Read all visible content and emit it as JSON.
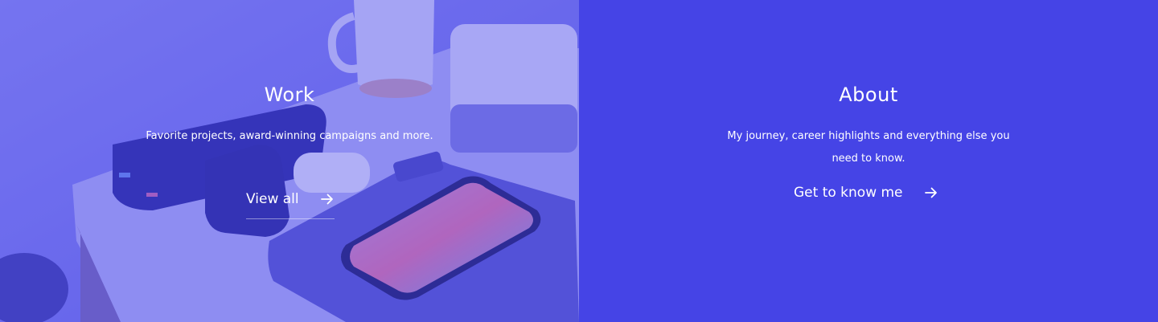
{
  "work": {
    "title": "Work",
    "description": "Favorite projects, award-winning campaigns and more.",
    "cta_label": "View all",
    "cta_icon": "arrow-right-icon",
    "overlay_color": "#6b6bf0"
  },
  "about": {
    "title": "About",
    "description": "My journey, career highlights and everything else you need to know.",
    "cta_label": "Get to know me",
    "cta_icon": "arrow-right-icon",
    "background_color": "#4544e6"
  }
}
